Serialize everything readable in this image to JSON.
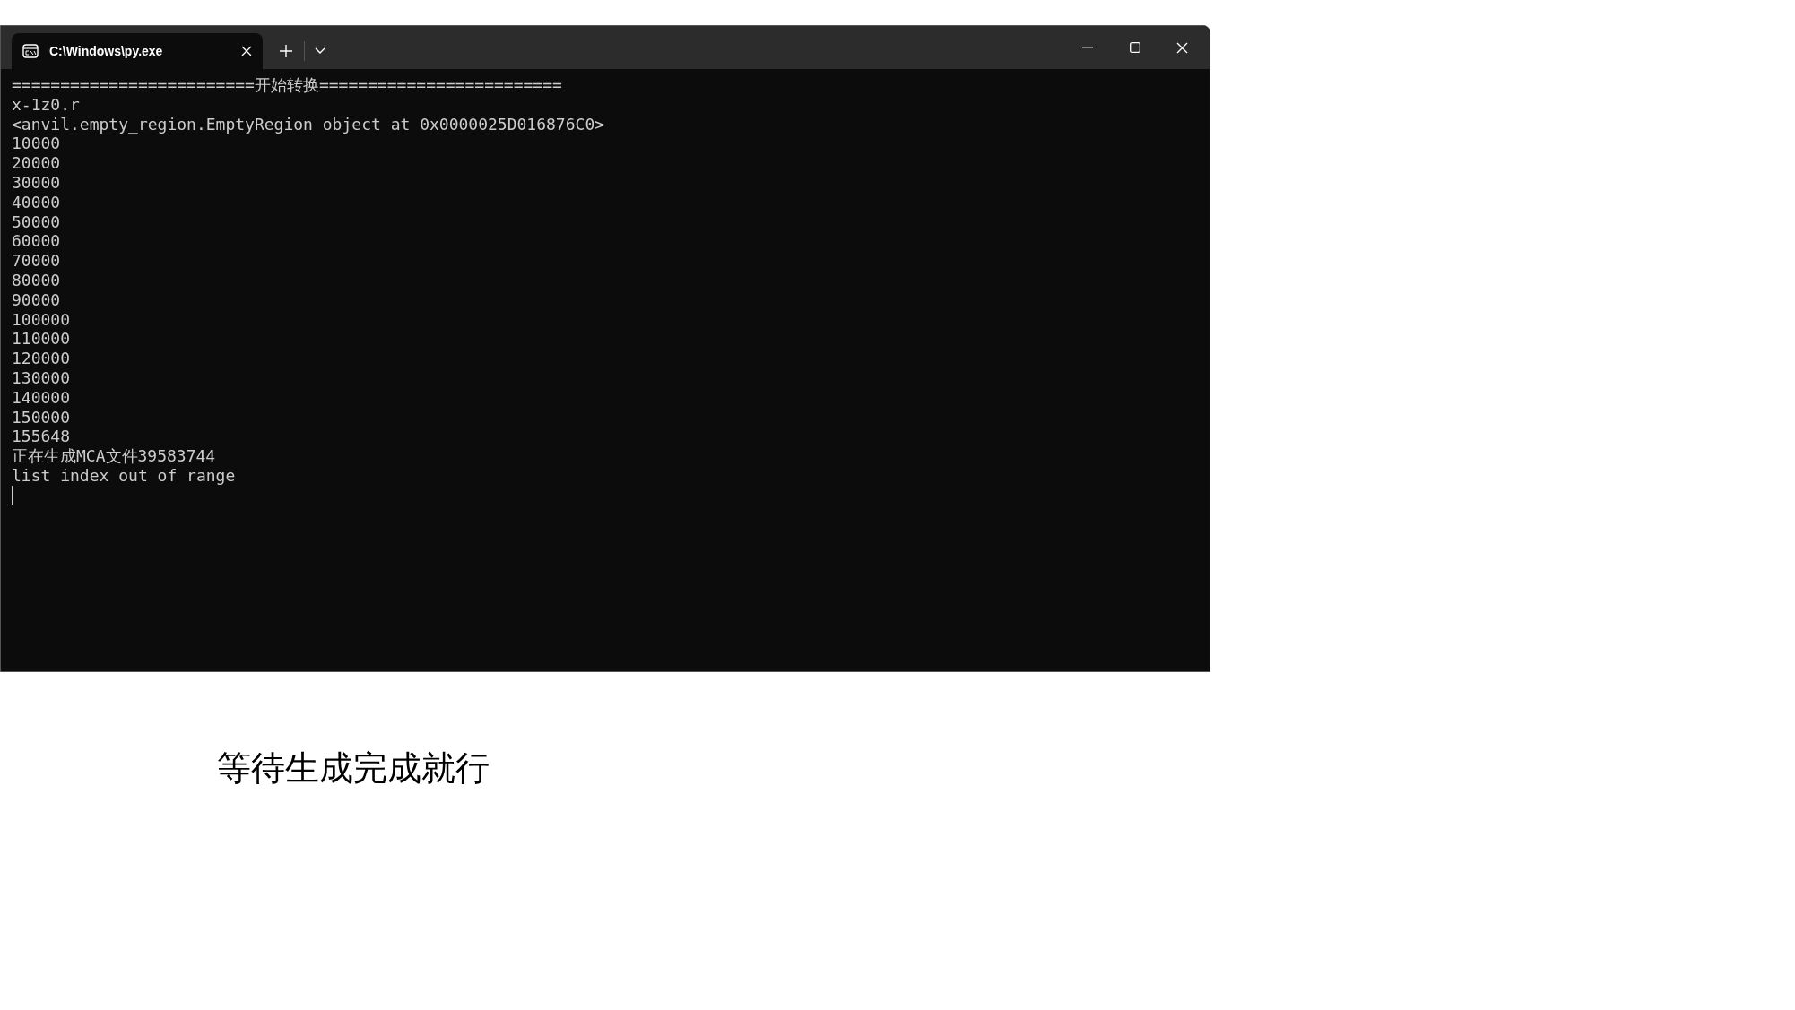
{
  "window": {
    "tab": {
      "title": "C:\\Windows\\py.exe",
      "selected": true
    }
  },
  "console": {
    "lines": [
      "=========================开始转换=========================",
      "x-1z0.r",
      "<anvil.empty_region.EmptyRegion object at 0x0000025D016876C0>",
      "10000",
      "20000",
      "30000",
      "40000",
      "50000",
      "60000",
      "70000",
      "80000",
      "90000",
      "100000",
      "110000",
      "120000",
      "130000",
      "140000",
      "150000",
      "155648",
      "正在生成MCA文件39583744",
      "list index out of range"
    ],
    "cursor": true
  },
  "caption": "等待生成完成就行"
}
